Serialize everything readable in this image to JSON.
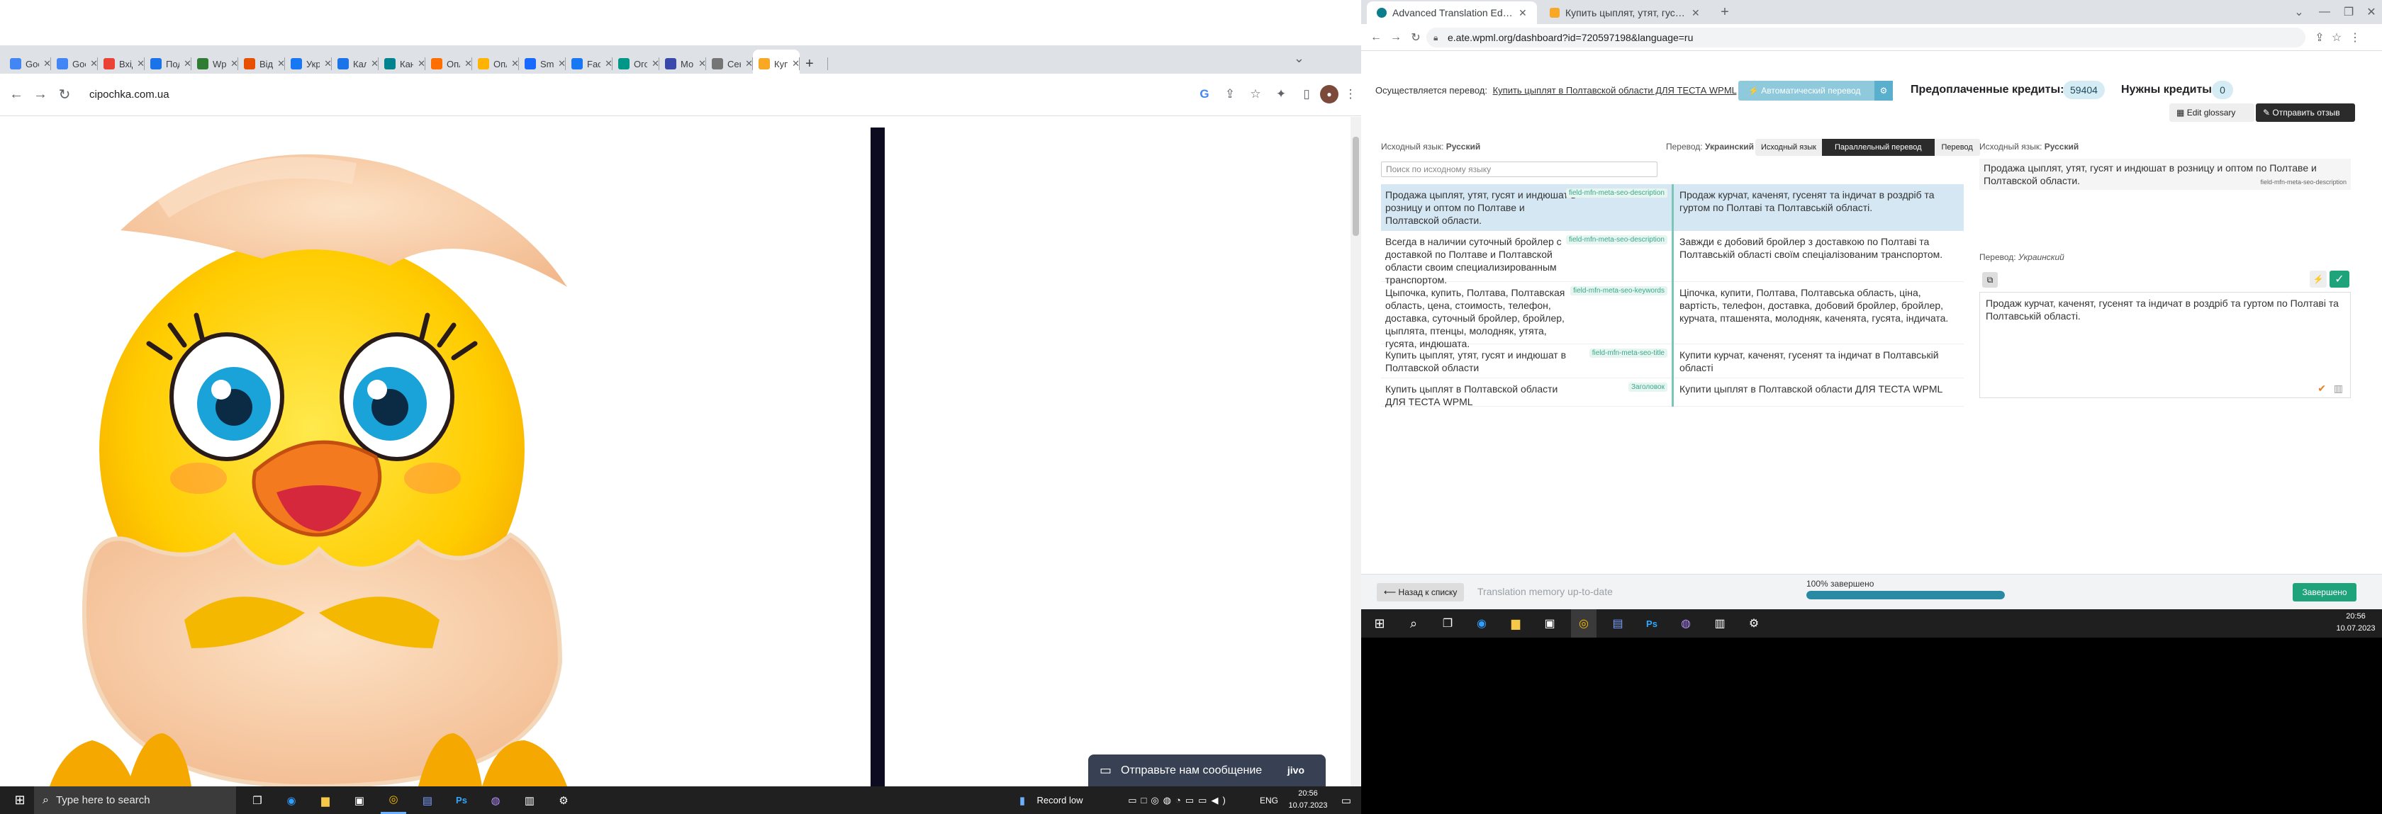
{
  "left_browser": {
    "tabs": [
      {
        "label": "Goog",
        "icon": "google-docs-icon",
        "color": "#4285f4"
      },
      {
        "label": "Goog",
        "icon": "google-docs-icon",
        "color": "#4285f4"
      },
      {
        "label": "Вхідн",
        "icon": "gmail-icon",
        "color": "#ea4335"
      },
      {
        "label": "Подв",
        "icon": "site-icon",
        "color": "#1a73e8"
      },
      {
        "label": "Wpho",
        "icon": "site-icon",
        "color": "#2e7d32"
      },
      {
        "label": "Відгу",
        "icon": "site-icon",
        "color": "#e65100"
      },
      {
        "label": "Украї",
        "icon": "facebook-icon",
        "color": "#1877f2"
      },
      {
        "label": "Кален",
        "icon": "calendar-icon",
        "color": "#1a73e8"
      },
      {
        "label": "Канди",
        "icon": "site-icon",
        "color": "#00838f"
      },
      {
        "label": "Опла",
        "icon": "site-icon",
        "color": "#ff6f00"
      },
      {
        "label": "Опла",
        "icon": "site-icon",
        "color": "#ffb300"
      },
      {
        "label": "Smar",
        "icon": "behance-icon",
        "color": "#1769ff"
      },
      {
        "label": "Faceb",
        "icon": "facebook-icon",
        "color": "#1877f2"
      },
      {
        "label": "Огол",
        "icon": "site-icon",
        "color": "#009688"
      },
      {
        "label": "Мон",
        "icon": "site-icon",
        "color": "#3949ab"
      },
      {
        "label": "Сексн",
        "icon": "site-icon",
        "color": "#757575"
      },
      {
        "label": "Купи",
        "icon": "cipochka-icon",
        "color": "#f9a825"
      }
    ],
    "url": "cipochka.com.ua",
    "chat_label": "Отправьте нам сообщение",
    "chat_brand": "jivo"
  },
  "taskbar_left": {
    "search_placeholder": "Type here to search",
    "record_label": "Record low",
    "lang": "ENG",
    "time": "20:56",
    "date": "10.07.2023"
  },
  "right_browser": {
    "tabs": [
      {
        "label": "Advanced Translation Editor - W"
      },
      {
        "label": "Купить цыплят, утят, гусят и ин"
      }
    ],
    "url": "e.ate.wpml.org/dashboard?id=720597198&language=ru"
  },
  "editor": {
    "translating_prefix": "Осуществляется перевод:",
    "translating_link": "Купить цыплят в Полтавской области ДЛЯ ТЕСТА WPML",
    "auto_translate": "Автоматический перевод",
    "prepaid_label": "Предоплаченные кредиты:",
    "prepaid_value": "59404",
    "needed_label": "Нужны кредиты",
    "needed_value": "0",
    "glossary_btn": "Edit glossary",
    "feedback_btn": "Отправить отзыв",
    "source_lang_label": "Исходный язык:",
    "source_lang": "Русский",
    "translation_label": "Перевод:",
    "target_lang": "Украинский",
    "view_tabs": [
      "Исходный язык",
      "Параллельный перевод",
      "Перевод"
    ],
    "search_placeholder": "Поиск по исходному языку",
    "rows": [
      {
        "src": "Продажа цыплят, утят, гусят и индюшат в розницу и оптом по Полтаве и Полтавской области.",
        "field": "field-mfn-meta-seo-description",
        "dst": "Продаж курчат, каченят, гусенят та індичат в роздріб та гуртом по Полтаві та Полтавській області."
      },
      {
        "src": "Всегда в наличии суточный бройлер с доставкой по Полтаве и Полтавской области своим специализированным транспортом.",
        "field": "field-mfn-meta-seo-description",
        "dst": "Завжди є добовий бройлер з доставкою по Полтаві та Полтавській області своїм спеціалізованим транспортом."
      },
      {
        "src": "Цыпочка, купить, Полтава, Полтавская область, цена, стоимость, телефон, доставка, суточный бройлер, бройлер, цыплята, птенцы, молодняк, утята, гусята, индюшата.",
        "field": "field-mfn-meta-seo-keywords",
        "dst": "Ціпочка, купити, Полтава, Полтавська область, ціна, вартість, телефон, доставка, добовий бройлер, бройлер, курчата, пташенята, молодняк, каченята, гусята, індичата."
      },
      {
        "src": "Купить цыплят, утят, гусят и индюшат в Полтавской области",
        "field": "field-mfn-meta-seo-title",
        "dst": "Купити курчат, каченят, гусенят та індичат в Полтавській області"
      },
      {
        "src": "Купить цыплят в Полтавской области ДЛЯ ТЕСТА WPML",
        "field": "Заголовок",
        "dst": "Купити цыплят в Полтавской области ДЛЯ ТЕСТА WPML"
      }
    ],
    "side_source_label": "Исходный язык:",
    "side_source_lang": "Русский",
    "side_source_text": "Продажа цыплят, утят, гусят и индюшат в розницу и оптом по Полтаве и Полтавской области.",
    "side_field": "field-mfn-meta-seo-description",
    "side_translation_label": "Перевод:",
    "side_translation_lang": "Украинский",
    "side_translation_text": "Продаж курчат, каченят, гусенят та індичат в роздріб та гуртом по Полтаві та Полтавській області.",
    "back_btn": "Назад к списку",
    "tm_status": "Translation memory up-to-date",
    "progress_label": "100% завершено",
    "progress": 1.0,
    "finish_btn": "Завершено"
  },
  "taskbar_right": {
    "time": "20:56",
    "date": "10.07.2023"
  }
}
